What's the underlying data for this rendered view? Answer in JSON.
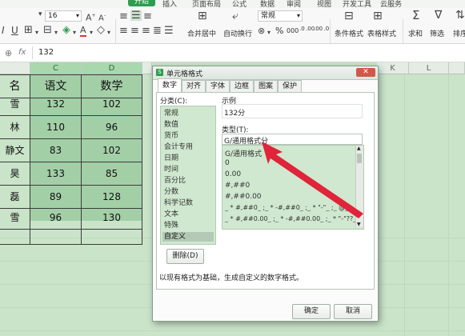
{
  "ribbon": {
    "tabs": [
      "开始",
      "插入",
      "页面布局",
      "公式",
      "数据",
      "审阅",
      "视图",
      "开发工具",
      "云服务"
    ],
    "font_size": "16",
    "number_format": "常规",
    "labels": {
      "merge_center": "合并居中",
      "wrap_text": "自动换行",
      "conditional_format": "条件格式",
      "table_style": "表格样式",
      "sum": "求和",
      "filter": "筛选",
      "sort": "排序"
    },
    "percent_symbol": "%",
    "decimal_increase": ".0 .00",
    "decimal_decrease": ".00 .0"
  },
  "formula_bar": {
    "fx": "fx",
    "value": "132"
  },
  "columns": [
    "C",
    "D",
    "K",
    "L"
  ],
  "table": {
    "headers": [
      "名",
      "语文",
      "数学"
    ],
    "rows": [
      [
        "雪",
        "132",
        "102"
      ],
      [
        "林",
        "110",
        "96"
      ],
      [
        "静文",
        "83",
        "102"
      ],
      [
        "昊",
        "133",
        "85"
      ],
      [
        "磊",
        "89",
        "128"
      ],
      [
        "雪",
        "96",
        "130"
      ]
    ]
  },
  "dialog": {
    "title": "单元格格式",
    "close": "✕",
    "tabs": [
      "数字",
      "对齐",
      "字体",
      "边框",
      "图案",
      "保护"
    ],
    "category_label": "分类(C):",
    "categories": [
      "常规",
      "数值",
      "货币",
      "会计专用",
      "日期",
      "时间",
      "百分比",
      "分数",
      "科学记数",
      "文本",
      "特殊",
      "自定义"
    ],
    "selected_category": "自定义",
    "sample_label": "示例",
    "sample_value": "132分",
    "type_label": "类型(T):",
    "type_value": "G/通用格式分",
    "type_list": [
      "G/通用格式",
      "0",
      "0.00",
      "#,##0",
      "#,##0.00",
      "_ * #,##0_ ;_ * -#,##0_ ;_ * \"-\"_ ;_ @_",
      "_ * #,##0.00_ ;_ * -#,##0.00_ ;_ * \"-\"??_ ;_ @_"
    ],
    "delete_button": "删除(D)",
    "description": "以现有格式为基础，生成自定义的数字格式。",
    "ok_button": "确定",
    "cancel_button": "取消"
  },
  "colors": {
    "accent": "#2e9d4f",
    "grid_bg": "#c9e4c9",
    "arrow": "#e0243a"
  }
}
